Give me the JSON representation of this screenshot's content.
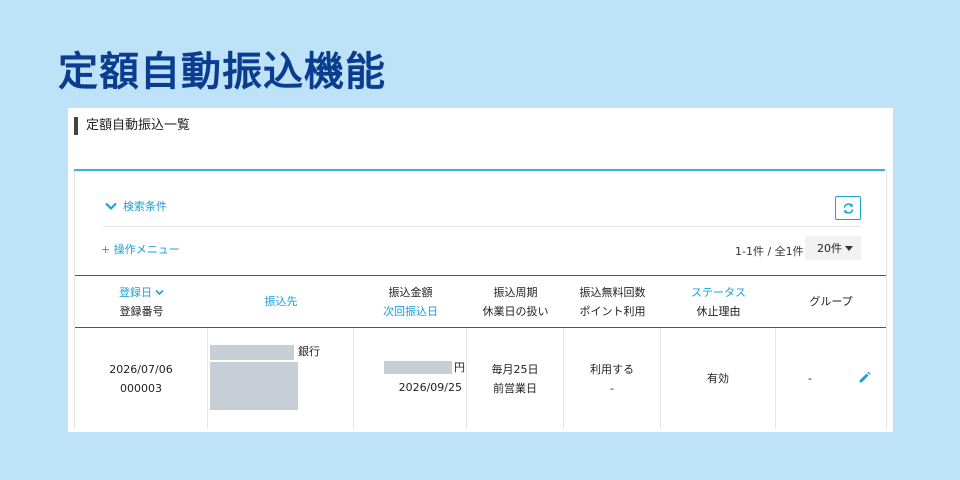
{
  "page": {
    "title": "定額自動振込機能"
  },
  "panel": {
    "section_title": "定額自動振込一覧"
  },
  "search": {
    "toggle_label": "検索条件"
  },
  "toolbar": {
    "ops_menu_label": "操作メニュー",
    "ops_menu_prefix": "+"
  },
  "paging": {
    "summary": "1-1件 / 全1件",
    "per_page": "20件"
  },
  "table": {
    "headers": {
      "registered_date": "登録日",
      "registered_no": "登録番号",
      "payee": "振込先",
      "amount": "振込金額",
      "next_date": "次回振込日",
      "cycle": "振込周期",
      "holiday": "休業日の扱い",
      "free_count": "振込無料回数",
      "points": "ポイント利用",
      "status": "ステータス",
      "suspend_reason": "休止理由",
      "group": "グループ"
    },
    "row": {
      "registered_date": "2026/07/06",
      "registered_no": "000003",
      "payee_bank_suffix": "銀行",
      "amount_unit": "円",
      "next_date": "2026/09/25",
      "cycle": "毎月25日",
      "holiday": "前営業日",
      "free_use": "利用する",
      "points": "-",
      "status": "有効",
      "group": "-"
    }
  },
  "colors": {
    "background": "#bee3f8",
    "title": "#0a3d8f",
    "accent": "#1a9fd8",
    "rule": "#3ab0e2",
    "mask": "#c8ced6"
  },
  "icons": {
    "search_toggle": "chevron-down-icon",
    "sort": "chevron-down-icon",
    "refresh": "refresh-icon",
    "per_page": "caret-down-icon",
    "edit": "pencil-icon"
  }
}
